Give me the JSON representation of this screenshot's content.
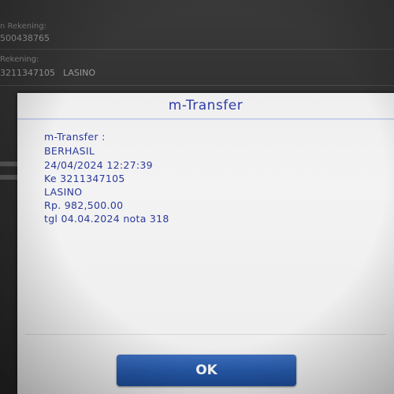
{
  "background": {
    "rows": [
      {
        "label": "n Rekening:",
        "value": "500438765"
      },
      {
        "label": "Rekening:",
        "value": "3211347105",
        "value2": "LASINO"
      }
    ]
  },
  "dialog": {
    "title": "m-Transfer",
    "message_lines": [
      "m-Transfer :",
      "BERHASIL",
      "24/04/2024 12:27:39",
      "Ke 3211347105",
      "LASINO",
      "Rp. 982,500.00",
      "tgl 04.04.2024 nota 318"
    ],
    "ok_label": "OK"
  },
  "colors": {
    "title_text": "#2f3da8",
    "message_text": "#2b3a9c",
    "ok_button": "#2558a8"
  }
}
